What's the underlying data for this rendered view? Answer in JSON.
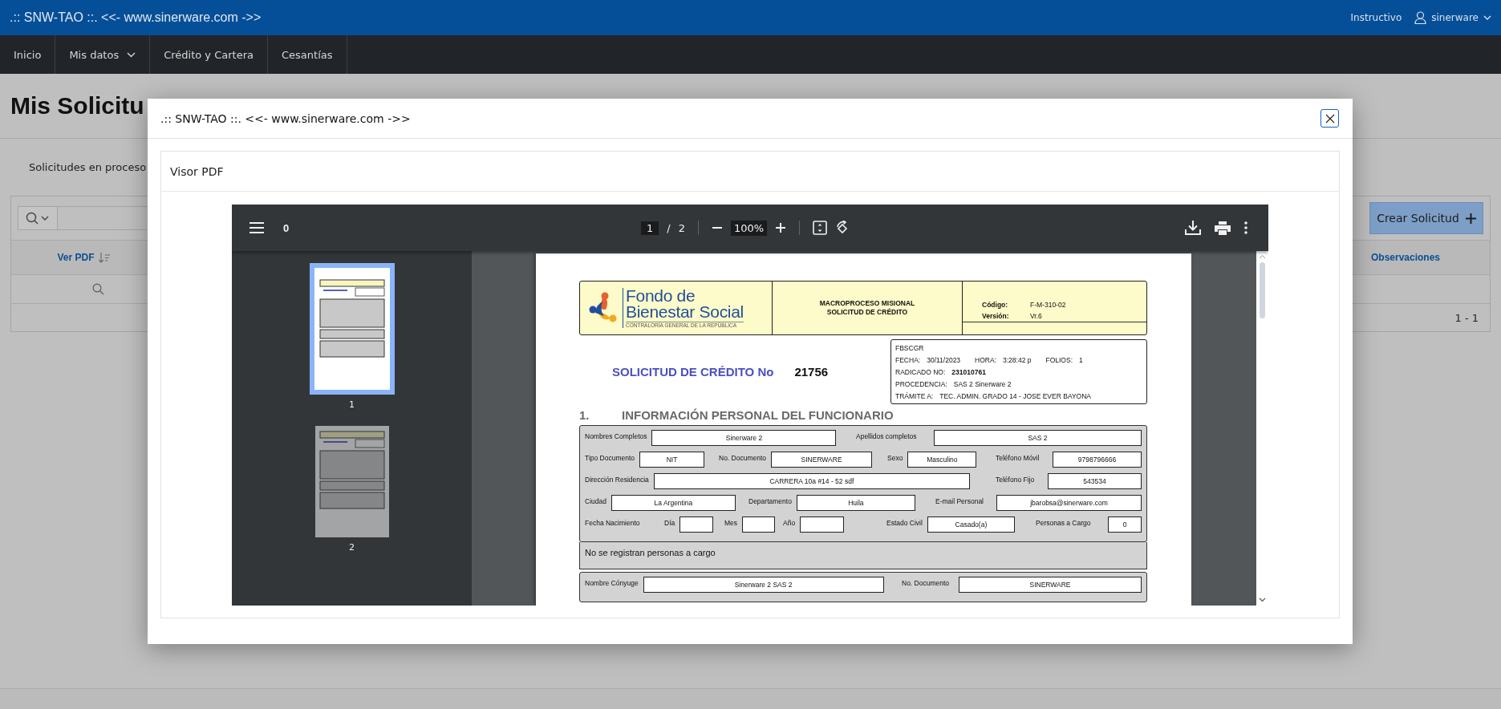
{
  "topbar": {
    "title": ".:: SNW-TAO ::. <<- www.sinerware.com ->>",
    "link": "Instructivo",
    "user": "sinerware"
  },
  "nav": [
    {
      "label": "Inicio",
      "dropdown": false
    },
    {
      "label": "Mis datos",
      "dropdown": true
    },
    {
      "label": "Crédito y Cartera",
      "dropdown": false
    },
    {
      "label": "Cesantías",
      "dropdown": false
    }
  ],
  "page": {
    "title": "Mis Solicitu",
    "tab": "Solicitudes en proceso",
    "create_button": "Crear Solicitud",
    "columns": [
      {
        "label": "Ver PDF",
        "sortable": true
      },
      {
        "label": "Observaciones",
        "sortable": false
      }
    ],
    "pagination": "1 - 1"
  },
  "modal": {
    "title": ".:: SNW-TAO ::. <<- www.sinerware.com ->>",
    "card_title": "Visor PDF",
    "viewer": {
      "title": "0",
      "page": "1",
      "page_count": "2",
      "separator": "/",
      "zoom": "100%",
      "thumbnails": [
        {
          "label": "1",
          "selected": true
        },
        {
          "label": "2",
          "selected": false
        }
      ],
      "document": {
        "logo": {
          "line1": "Fondo de",
          "line2": "Bienestar Social",
          "subtitle": "CONTRALORÍA GENERAL DE LA REPÚBLICA"
        },
        "header_center": [
          "MACROPROCESO MISIONAL",
          "SOLICITUD DE CRÉDITO"
        ],
        "header_fields": [
          {
            "label": "Código:",
            "value": "F-M-310-02"
          },
          {
            "label": "Versión:",
            "value": "Vr.6"
          }
        ],
        "request_title": "SOLICITUD DE CRÉDITO No",
        "request_number": "21756",
        "info_lines": [
          [
            {
              "label": "FBSCGR"
            }
          ],
          [
            {
              "label": "FECHA:",
              "value": "30/11/2023",
              "bold": false
            },
            {
              "label": "HORA:",
              "value": "3:28:42 p",
              "bold": false
            },
            {
              "label": "FOLIOS:",
              "value": "1",
              "bold": false
            }
          ],
          [
            {
              "label": "RADICADO NO:",
              "value": "231010761",
              "bold": true
            }
          ],
          [
            {
              "label": "PROCEDENCIA:",
              "value": "SAS 2 Sinerware 2",
              "bold": false
            }
          ],
          [
            {
              "label": "TRÁMITE A:",
              "value": "TEC. ADMIN. GRADO 14 - JOSE EVER BAYONA",
              "bold": false
            }
          ]
        ],
        "section": {
          "number": "1.",
          "title": "INFORMACIÓN PERSONAL DEL FUNCIONARIO"
        },
        "form_rows": [
          [
            {
              "label": "Nombres Completos",
              "kind": "box",
              "value": "Sinerware 2"
            },
            {
              "label": "Apellidos completos",
              "kind": "box",
              "value": "SAS 2"
            }
          ],
          [
            {
              "label": "Tipo Documento",
              "kind": "box",
              "value": "NIT"
            },
            {
              "label": "No. Documento",
              "kind": "box",
              "value": "SINERWARE"
            },
            {
              "label": "Sexo",
              "kind": "box",
              "value": "Masculino"
            },
            {
              "label": "Teléfono Móvil",
              "kind": "box",
              "value": "9798796666"
            }
          ],
          [
            {
              "label": "Dirección Residencia",
              "kind": "box",
              "value": "CARRERA 10a #14 - 52 sdf"
            },
            {
              "label": "Teléfono Fijo",
              "kind": "box",
              "value": "543534"
            }
          ],
          [
            {
              "label": "Ciudad",
              "kind": "box",
              "value": "La Argentina"
            },
            {
              "label": "Departamento",
              "kind": "box",
              "value": "Huila"
            },
            {
              "label": "E-mail Personal",
              "kind": "box",
              "value": "jbarobsa@sinerware.com"
            }
          ],
          [
            {
              "label": "Fecha Nacimiento",
              "kind": "label"
            },
            {
              "label": "Día",
              "kind": "box"
            },
            {
              "label": "Mes",
              "kind": "box"
            },
            {
              "label": "Año",
              "kind": "box"
            },
            {
              "label": "Estado Civil",
              "kind": "box",
              "value": "Casado(a)"
            },
            {
              "label": "Personas a Cargo",
              "kind": "box",
              "value": "0"
            }
          ]
        ],
        "dependents_note": "No se registran personas a cargo",
        "spouse_row": [
          {
            "label": "Nombre Cónyuge",
            "kind": "box",
            "value": "Sinerware 2 SAS 2"
          },
          {
            "label": "No. Documento",
            "kind": "box",
            "value": "SINERWARE"
          }
        ]
      }
    }
  }
}
